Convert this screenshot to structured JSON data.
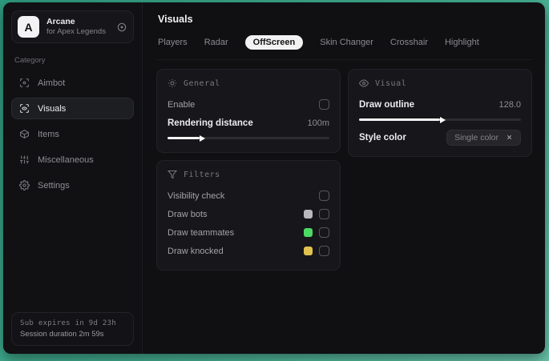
{
  "app": {
    "logo_letter": "A",
    "name": "Arcane",
    "subtitle": "for Apex Legends"
  },
  "sidebar": {
    "category_label": "Category",
    "items": [
      {
        "label": "Aimbot"
      },
      {
        "label": "Visuals"
      },
      {
        "label": "Items"
      },
      {
        "label": "Miscellaneous"
      },
      {
        "label": "Settings"
      }
    ],
    "footer": {
      "sub_expires": "Sub expires in 9d 23h",
      "session_duration": "Session duration 2m 59s"
    }
  },
  "main": {
    "title": "Visuals",
    "active_tab": "OffScreen",
    "tabs": [
      {
        "label": "Players"
      },
      {
        "label": "Radar"
      },
      {
        "label": "OffScreen"
      },
      {
        "label": "Skin Changer"
      },
      {
        "label": "Crosshair"
      },
      {
        "label": "Highlight"
      }
    ]
  },
  "panels": {
    "general": {
      "title": "General",
      "enable_label": "Enable",
      "enable_checked": false,
      "rendering_distance_label": "Rendering distance",
      "rendering_distance_value": "100m",
      "rendering_distance_fill": "20%"
    },
    "filters": {
      "title": "Filters",
      "rows": [
        {
          "label": "Visibility check",
          "swatch": null,
          "checked": false
        },
        {
          "label": "Draw bots",
          "swatch": "#b9b9bb",
          "checked": false
        },
        {
          "label": "Draw teammates",
          "swatch": "#4cd964",
          "checked": false
        },
        {
          "label": "Draw knocked",
          "swatch": "#e2c24f",
          "checked": false
        }
      ]
    },
    "visual": {
      "title": "Visual",
      "draw_outline_label": "Draw outline",
      "draw_outline_value": "128.0",
      "draw_outline_fill": "50%",
      "style_color_label": "Style color",
      "style_color_value": "Single color"
    }
  },
  "colors": {
    "desktop_background": "#44b093",
    "window_background": "#101013",
    "panel_background": "#17171b",
    "active_tab_background": "#f2f2f2",
    "swatch_bots": "#b9b9bb",
    "swatch_teammates": "#4cd964",
    "swatch_knocked": "#e2c24f"
  }
}
